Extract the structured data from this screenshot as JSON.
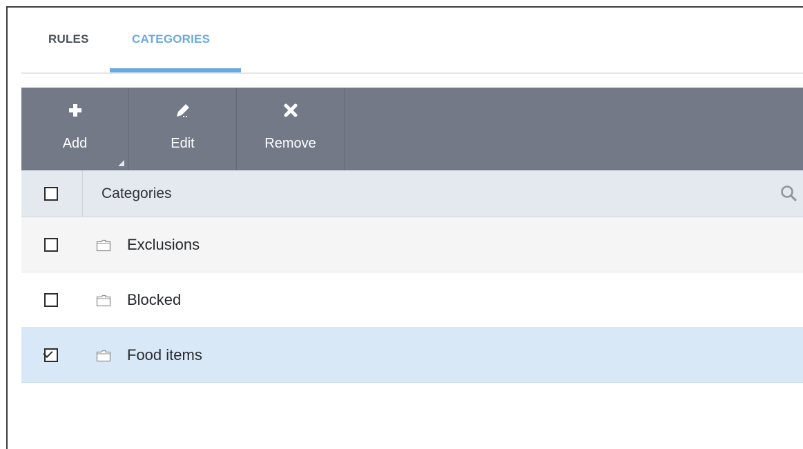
{
  "tabs": [
    {
      "label": "RULES",
      "active": false
    },
    {
      "label": "CATEGORIES",
      "active": true
    }
  ],
  "toolbar": {
    "add": {
      "label": "Add",
      "icon": "plus-icon"
    },
    "edit": {
      "label": "Edit",
      "icon": "pencil-icon"
    },
    "remove": {
      "label": "Remove",
      "icon": "x-icon"
    }
  },
  "table": {
    "header": {
      "label": "Categories",
      "select_all_checked": false,
      "search_icon": "search-icon"
    },
    "rows": [
      {
        "label": "Exclusions",
        "checked": false,
        "icon": "folder-icon"
      },
      {
        "label": "Blocked",
        "checked": false,
        "icon": "folder-icon"
      },
      {
        "label": "Food items",
        "checked": true,
        "icon": "folder-icon"
      }
    ]
  },
  "colors": {
    "accent": "#6aa9e0",
    "toolbar_bg": "#737987",
    "header_bg": "#e4e8ef",
    "selected_row_bg": "#d9e8f6",
    "alt_row_bg": "#f5f5f5"
  }
}
